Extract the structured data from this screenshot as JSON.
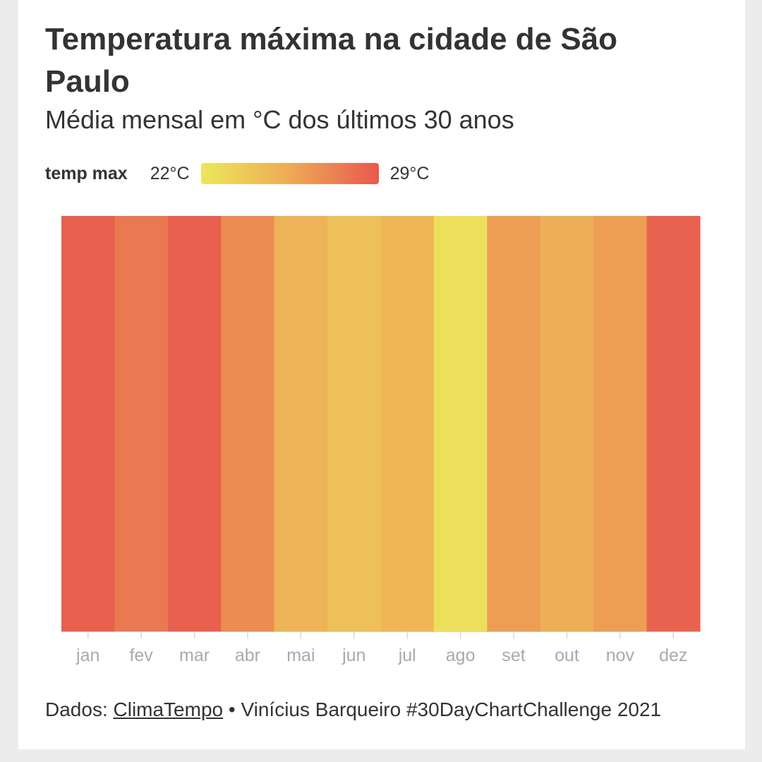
{
  "title": "Temperatura máxima na cidade de São Paulo",
  "subtitle": "Média mensal em °C dos últimos 30 anos",
  "legend": {
    "title": "temp max",
    "min_label": "22°C",
    "max_label": "29°C"
  },
  "colors": {
    "scale_low": "#ece75b",
    "scale_mid": "#eeaa55",
    "scale_high": "#e8594e",
    "tick": "#d9d9d9",
    "tick_label": "#aaaaaa"
  },
  "chart_data": {
    "type": "heatmap",
    "title": "Temperatura máxima na cidade de São Paulo",
    "subtitle": "Média mensal em °C dos últimos 30 anos",
    "legend_title": "temp max",
    "color_scale": {
      "min": 22,
      "max": 29
    },
    "categories": [
      "jan",
      "fev",
      "mar",
      "abr",
      "mai",
      "jun",
      "jul",
      "ago",
      "set",
      "out",
      "nov",
      "dez"
    ],
    "values": [
      28.7,
      27.6,
      28.7,
      26.8,
      25.0,
      24.2,
      24.8,
      22.4,
      26.0,
      25.2,
      26.0,
      28.6
    ],
    "legend_position": "top-left"
  },
  "footer": {
    "prefix": "Dados: ",
    "source_link": "ClimaTempo",
    "suffix": " • Vinícius Barqueiro #30DayChartChallenge 2021"
  }
}
